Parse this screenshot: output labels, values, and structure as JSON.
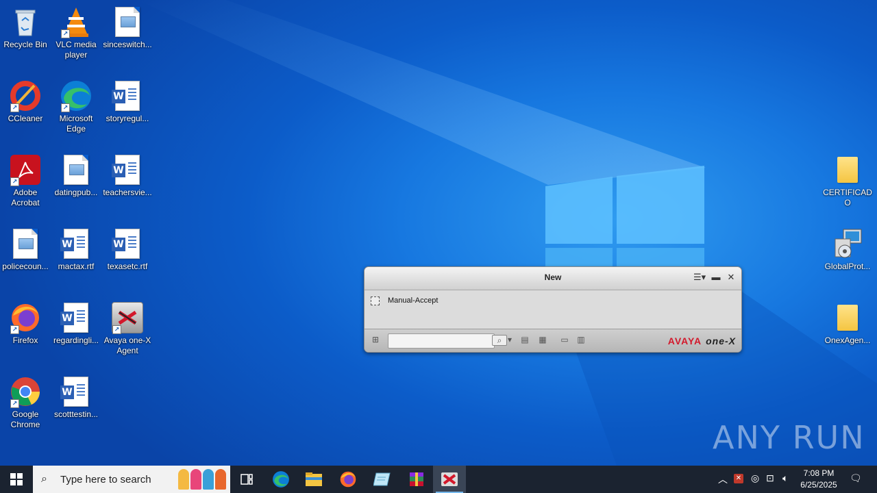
{
  "desktop": {
    "icons": [
      {
        "label": "Recycle Bin",
        "icon": "recycle-bin-icon"
      },
      {
        "label": "VLC media player",
        "icon": "vlc-icon"
      },
      {
        "label": "sinceswitch...",
        "icon": "image-file-icon"
      },
      {
        "label": "CCleaner",
        "icon": "ccleaner-icon"
      },
      {
        "label": "Microsoft Edge",
        "icon": "edge-icon"
      },
      {
        "label": "storyregul...",
        "icon": "word-doc-icon"
      },
      {
        "label": "Adobe Acrobat",
        "icon": "acrobat-icon"
      },
      {
        "label": "datingpub...",
        "icon": "image-file-icon"
      },
      {
        "label": "teachersvie...",
        "icon": "word-doc-icon"
      },
      {
        "label": "policecoun...",
        "icon": "image-file-icon"
      },
      {
        "label": "mactax.rtf",
        "icon": "word-doc-icon"
      },
      {
        "label": "texasetc.rtf",
        "icon": "word-doc-icon"
      },
      {
        "label": "Firefox",
        "icon": "firefox-icon"
      },
      {
        "label": "regardingli...",
        "icon": "word-doc-icon"
      },
      {
        "label": "Avaya one-X Agent",
        "icon": "avaya-icon"
      },
      {
        "label": "Google Chrome",
        "icon": "chrome-icon"
      },
      {
        "label": "scotttestin...",
        "icon": "word-doc-icon"
      },
      {
        "label": "CERTIFICADO",
        "icon": "folder-icon"
      },
      {
        "label": "GlobalProt...",
        "icon": "installer-icon"
      },
      {
        "label": "OnexAgen...",
        "icon": "folder-icon"
      }
    ]
  },
  "agent_window": {
    "title": "New",
    "checkbox_label": "Manual-Accept",
    "search_value": "",
    "brand_avaya": "AVAYA",
    "brand_onex": "one-X"
  },
  "watermark": "ANY RUN",
  "taskbar": {
    "search_placeholder": "Type here to search",
    "time": "7:08 PM",
    "date": "6/25/2025"
  }
}
